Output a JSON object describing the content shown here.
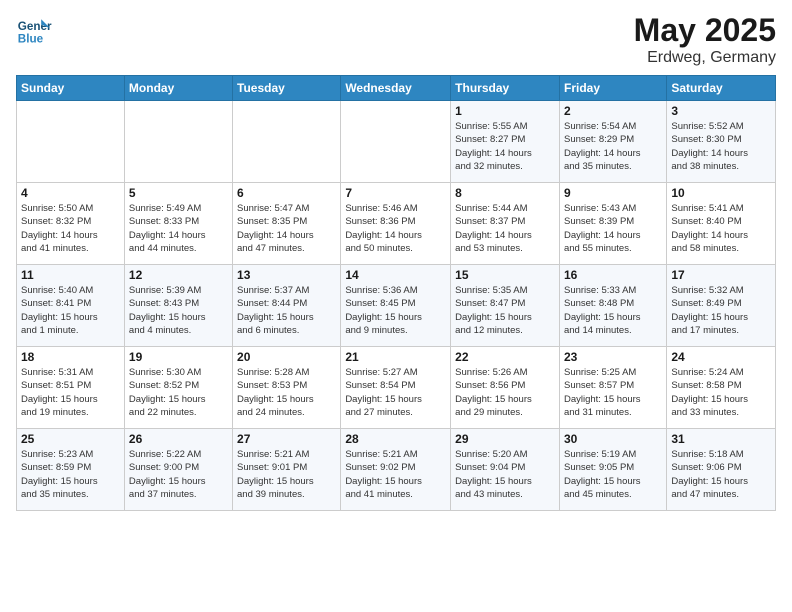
{
  "header": {
    "logo_line1": "General",
    "logo_line2": "Blue",
    "month": "May 2025",
    "location": "Erdweg, Germany"
  },
  "weekdays": [
    "Sunday",
    "Monday",
    "Tuesday",
    "Wednesday",
    "Thursday",
    "Friday",
    "Saturday"
  ],
  "weeks": [
    [
      {
        "day": "",
        "info": ""
      },
      {
        "day": "",
        "info": ""
      },
      {
        "day": "",
        "info": ""
      },
      {
        "day": "",
        "info": ""
      },
      {
        "day": "1",
        "info": "Sunrise: 5:55 AM\nSunset: 8:27 PM\nDaylight: 14 hours\nand 32 minutes."
      },
      {
        "day": "2",
        "info": "Sunrise: 5:54 AM\nSunset: 8:29 PM\nDaylight: 14 hours\nand 35 minutes."
      },
      {
        "day": "3",
        "info": "Sunrise: 5:52 AM\nSunset: 8:30 PM\nDaylight: 14 hours\nand 38 minutes."
      }
    ],
    [
      {
        "day": "4",
        "info": "Sunrise: 5:50 AM\nSunset: 8:32 PM\nDaylight: 14 hours\nand 41 minutes."
      },
      {
        "day": "5",
        "info": "Sunrise: 5:49 AM\nSunset: 8:33 PM\nDaylight: 14 hours\nand 44 minutes."
      },
      {
        "day": "6",
        "info": "Sunrise: 5:47 AM\nSunset: 8:35 PM\nDaylight: 14 hours\nand 47 minutes."
      },
      {
        "day": "7",
        "info": "Sunrise: 5:46 AM\nSunset: 8:36 PM\nDaylight: 14 hours\nand 50 minutes."
      },
      {
        "day": "8",
        "info": "Sunrise: 5:44 AM\nSunset: 8:37 PM\nDaylight: 14 hours\nand 53 minutes."
      },
      {
        "day": "9",
        "info": "Sunrise: 5:43 AM\nSunset: 8:39 PM\nDaylight: 14 hours\nand 55 minutes."
      },
      {
        "day": "10",
        "info": "Sunrise: 5:41 AM\nSunset: 8:40 PM\nDaylight: 14 hours\nand 58 minutes."
      }
    ],
    [
      {
        "day": "11",
        "info": "Sunrise: 5:40 AM\nSunset: 8:41 PM\nDaylight: 15 hours\nand 1 minute."
      },
      {
        "day": "12",
        "info": "Sunrise: 5:39 AM\nSunset: 8:43 PM\nDaylight: 15 hours\nand 4 minutes."
      },
      {
        "day": "13",
        "info": "Sunrise: 5:37 AM\nSunset: 8:44 PM\nDaylight: 15 hours\nand 6 minutes."
      },
      {
        "day": "14",
        "info": "Sunrise: 5:36 AM\nSunset: 8:45 PM\nDaylight: 15 hours\nand 9 minutes."
      },
      {
        "day": "15",
        "info": "Sunrise: 5:35 AM\nSunset: 8:47 PM\nDaylight: 15 hours\nand 12 minutes."
      },
      {
        "day": "16",
        "info": "Sunrise: 5:33 AM\nSunset: 8:48 PM\nDaylight: 15 hours\nand 14 minutes."
      },
      {
        "day": "17",
        "info": "Sunrise: 5:32 AM\nSunset: 8:49 PM\nDaylight: 15 hours\nand 17 minutes."
      }
    ],
    [
      {
        "day": "18",
        "info": "Sunrise: 5:31 AM\nSunset: 8:51 PM\nDaylight: 15 hours\nand 19 minutes."
      },
      {
        "day": "19",
        "info": "Sunrise: 5:30 AM\nSunset: 8:52 PM\nDaylight: 15 hours\nand 22 minutes."
      },
      {
        "day": "20",
        "info": "Sunrise: 5:28 AM\nSunset: 8:53 PM\nDaylight: 15 hours\nand 24 minutes."
      },
      {
        "day": "21",
        "info": "Sunrise: 5:27 AM\nSunset: 8:54 PM\nDaylight: 15 hours\nand 27 minutes."
      },
      {
        "day": "22",
        "info": "Sunrise: 5:26 AM\nSunset: 8:56 PM\nDaylight: 15 hours\nand 29 minutes."
      },
      {
        "day": "23",
        "info": "Sunrise: 5:25 AM\nSunset: 8:57 PM\nDaylight: 15 hours\nand 31 minutes."
      },
      {
        "day": "24",
        "info": "Sunrise: 5:24 AM\nSunset: 8:58 PM\nDaylight: 15 hours\nand 33 minutes."
      }
    ],
    [
      {
        "day": "25",
        "info": "Sunrise: 5:23 AM\nSunset: 8:59 PM\nDaylight: 15 hours\nand 35 minutes."
      },
      {
        "day": "26",
        "info": "Sunrise: 5:22 AM\nSunset: 9:00 PM\nDaylight: 15 hours\nand 37 minutes."
      },
      {
        "day": "27",
        "info": "Sunrise: 5:21 AM\nSunset: 9:01 PM\nDaylight: 15 hours\nand 39 minutes."
      },
      {
        "day": "28",
        "info": "Sunrise: 5:21 AM\nSunset: 9:02 PM\nDaylight: 15 hours\nand 41 minutes."
      },
      {
        "day": "29",
        "info": "Sunrise: 5:20 AM\nSunset: 9:04 PM\nDaylight: 15 hours\nand 43 minutes."
      },
      {
        "day": "30",
        "info": "Sunrise: 5:19 AM\nSunset: 9:05 PM\nDaylight: 15 hours\nand 45 minutes."
      },
      {
        "day": "31",
        "info": "Sunrise: 5:18 AM\nSunset: 9:06 PM\nDaylight: 15 hours\nand 47 minutes."
      }
    ]
  ]
}
